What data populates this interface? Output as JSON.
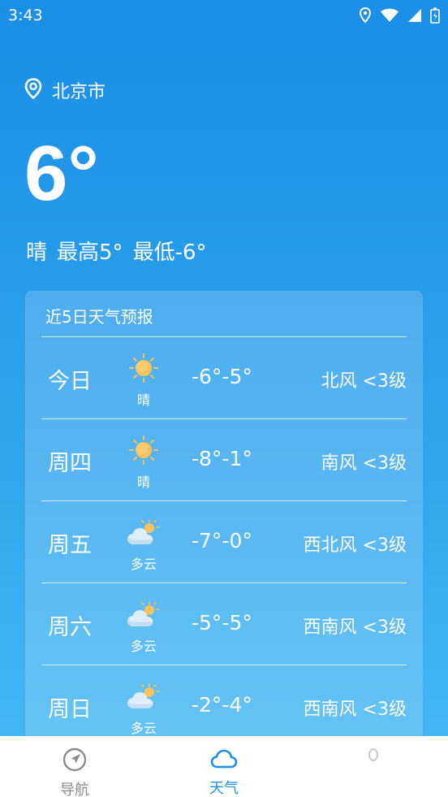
{
  "status_bar": {
    "time": "3:43",
    "icons": [
      "location-icon",
      "wifi-icon",
      "signal-icon",
      "battery-icon"
    ]
  },
  "location": {
    "icon": "location-pin-icon",
    "city": "北京市"
  },
  "current": {
    "temperature": "6°",
    "condition": "晴",
    "high": "最高5°",
    "low": "最低-6°"
  },
  "forecast": {
    "title": "近5日天气预报",
    "days": [
      {
        "day": "今日",
        "icon": "sun-icon",
        "condition": "晴",
        "temp_range": "-6°-5°",
        "wind": "北风 <3级"
      },
      {
        "day": "周四",
        "icon": "sun-icon",
        "condition": "晴",
        "temp_range": "-8°-1°",
        "wind": "南风 <3级"
      },
      {
        "day": "周五",
        "icon": "partly-cloudy-icon",
        "condition": "多云",
        "temp_range": "-7°-0°",
        "wind": "西北风 <3级"
      },
      {
        "day": "周六",
        "icon": "partly-cloudy-icon",
        "condition": "多云",
        "temp_range": "-5°-5°",
        "wind": "西南风 <3级"
      },
      {
        "day": "周日",
        "icon": "partly-cloudy-icon",
        "condition": "多云",
        "temp_range": "-2°-4°",
        "wind": "西南风 <3级"
      }
    ]
  },
  "bottom_nav": {
    "items": [
      {
        "label": "导航",
        "icon": "navigation-icon",
        "active": false
      },
      {
        "label": "天气",
        "icon": "cloud-icon",
        "active": true
      },
      {
        "label": "",
        "icon": "profile-icon",
        "active": false
      }
    ]
  },
  "colors": {
    "background_top": "#1a8fe6",
    "background_bottom": "#47b9f3",
    "nav_active": "#1e90ee",
    "nav_inactive": "#8a8a8a",
    "sun": "#f7b843"
  }
}
